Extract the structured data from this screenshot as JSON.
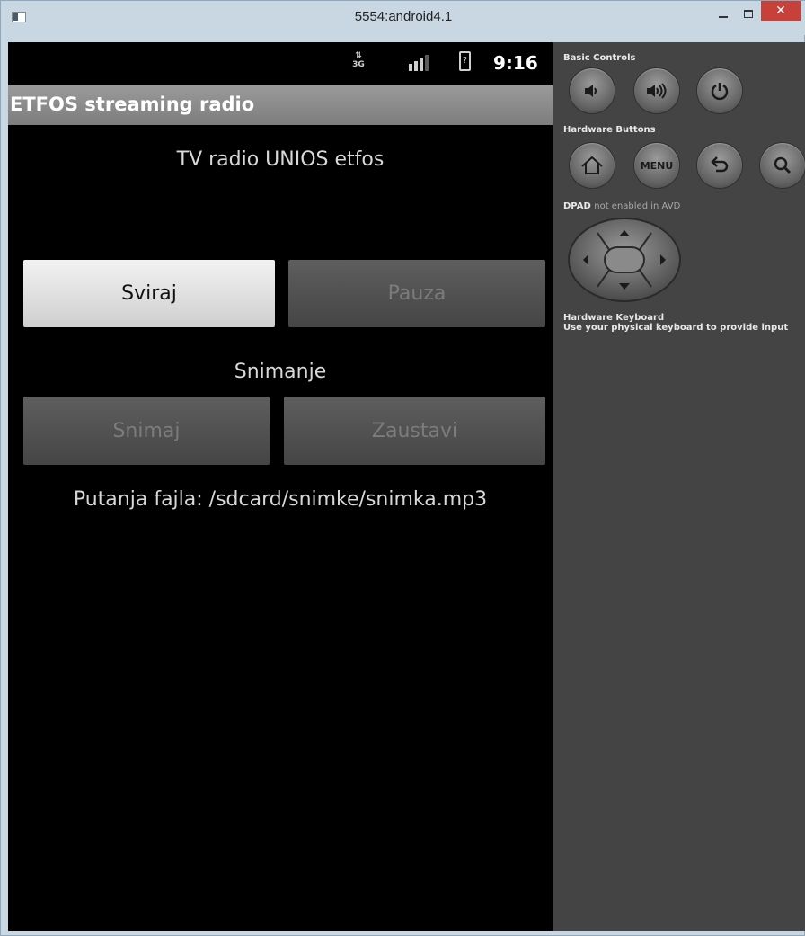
{
  "window": {
    "title": "5554:android4.1",
    "minimize_glyph": "",
    "close_glyph": "✕"
  },
  "status_bar": {
    "network": "3G",
    "battery_glyph": "?",
    "time": "9:16"
  },
  "app": {
    "title": "ETFOS streaming radio",
    "station_name": "TV radio UNIOS etfos",
    "play_label": "Sviraj",
    "pause_label": "Pauza",
    "recording_label": "Snimanje",
    "record_label": "Snimaj",
    "stop_label": "Zaustavi",
    "file_path": "Putanja fajla: /sdcard/snimke/snimka.mp3"
  },
  "panel": {
    "basic_controls": "Basic Controls",
    "hardware_buttons": "Hardware Buttons",
    "dpad_label": "DPAD",
    "dpad_note": "not enabled in AVD",
    "keyboard_title": "Hardware Keyboard",
    "keyboard_subtitle": "Use your physical keyboard to provide input",
    "menu_label": "MENU"
  },
  "icons": {
    "volume_down": "volume-down-icon",
    "volume_up": "volume-up-icon",
    "power": "power-icon",
    "home": "home-icon",
    "back": "back-icon",
    "search": "search-icon"
  }
}
